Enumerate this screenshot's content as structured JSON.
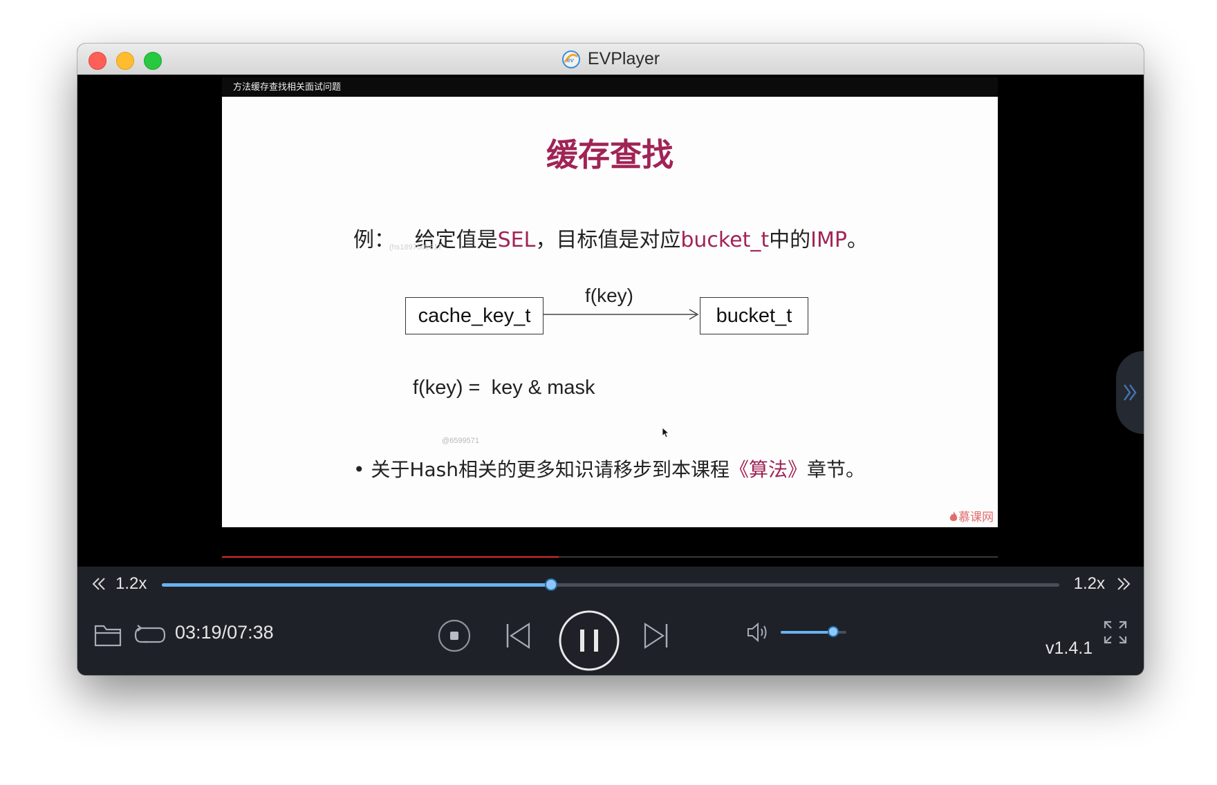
{
  "window": {
    "title": "EVPlayer"
  },
  "video": {
    "title_bar": "方法缓存查找相关面试问题",
    "slide": {
      "title": "缓存查找",
      "example": {
        "prefix": "例：",
        "p1": "给定值是",
        "sel": "SEL",
        "p2": "，目标值是对应",
        "bucket": "bucket_t",
        "p3": "中的",
        "imp": "IMP",
        "p4": "。"
      },
      "watermark_1": "(hs1897505617",
      "watermark_2": "@6599571",
      "diagram": {
        "left_box": "cache_key_t",
        "arrow_label": "f(key)",
        "right_box": "bucket_t"
      },
      "formula": "f(key) =  key & mask",
      "bullet": {
        "text": "• 关于Hash相关的更多知识请移步到本课程",
        "link": "《算法》",
        "suffix": "章节。"
      },
      "brand": "慕课网"
    },
    "progress_fraction": 0.434
  },
  "controls": {
    "speed_left": "1.2x",
    "speed_right": "1.2x",
    "seek_fraction": 0.434,
    "time": "03:19/07:38",
    "volume_fraction": 0.8,
    "version": "v1.4.1",
    "icons": [
      "folder-icon",
      "loop-icon",
      "stop-icon",
      "previous-icon",
      "pause-icon",
      "next-icon",
      "volume-icon",
      "fullscreen-icon",
      "rewind-icon",
      "fast-forward-icon",
      "expand-panel-icon"
    ]
  },
  "colors": {
    "accent": "#a02456",
    "seek": "#6ab2f2",
    "progress_red": "#e22c2c"
  }
}
